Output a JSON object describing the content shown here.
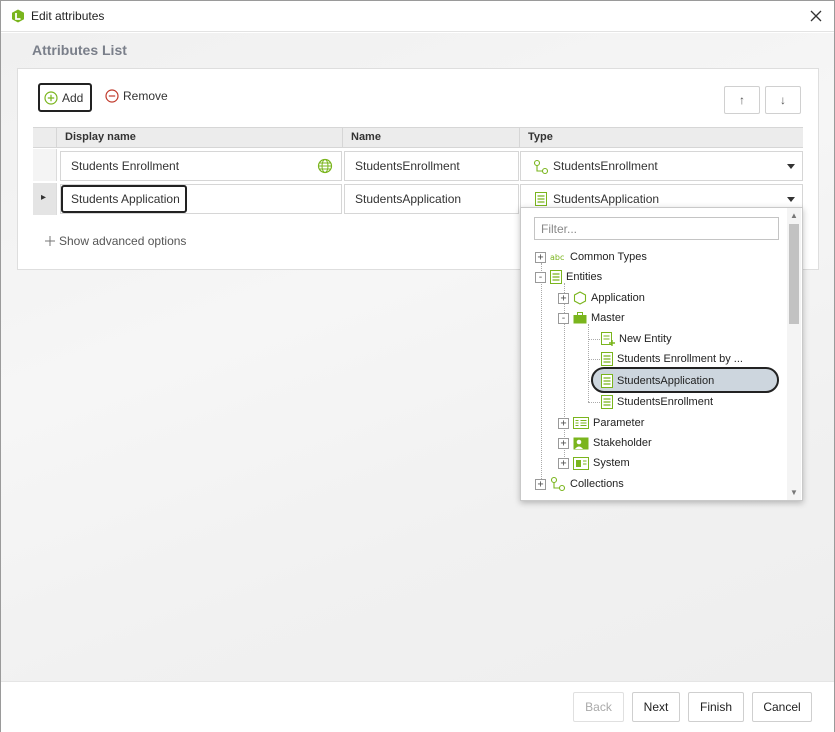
{
  "window": {
    "title": "Edit attributes",
    "app_icon": "app-logo-icon",
    "close_icon": "close-icon"
  },
  "section": {
    "title": "Attributes List"
  },
  "toolbar": {
    "add_label": "Add",
    "remove_label": "Remove",
    "move_up_label": "↑",
    "move_down_label": "↓"
  },
  "grid": {
    "columns": [
      "Display name",
      "Name",
      "Type"
    ],
    "rows": [
      {
        "display_name": "Students Enrollment",
        "name": "StudentsEnrollment",
        "type": "StudentsEnrollment",
        "type_icon": "collection-icon"
      },
      {
        "display_name": "Students Application",
        "name": "StudentsApplication",
        "type": "StudentsApplication",
        "type_icon": "entity-icon"
      }
    ],
    "row_marker": "▸"
  },
  "advanced_options": "Show advanced options",
  "type_dropdown": {
    "filter_placeholder": "Filter...",
    "tree": {
      "common_types": "Common Types",
      "entities": "Entities",
      "application": "Application",
      "master": "Master",
      "new_entity": "New Entity",
      "students_enrollment_by": "Students Enrollment by ...",
      "students_application": "StudentsApplication",
      "students_enrollment": "StudentsEnrollment",
      "parameter": "Parameter",
      "stakeholder": "Stakeholder",
      "system": "System",
      "collections": "Collections"
    },
    "selected": "StudentsApplication"
  },
  "footer": {
    "back": "Back",
    "next": "Next",
    "finish": "Finish",
    "cancel": "Cancel"
  },
  "colors": {
    "accent_green": "#7ab51d",
    "remove_red": "#c0392b",
    "selection": "#cdd6de"
  }
}
